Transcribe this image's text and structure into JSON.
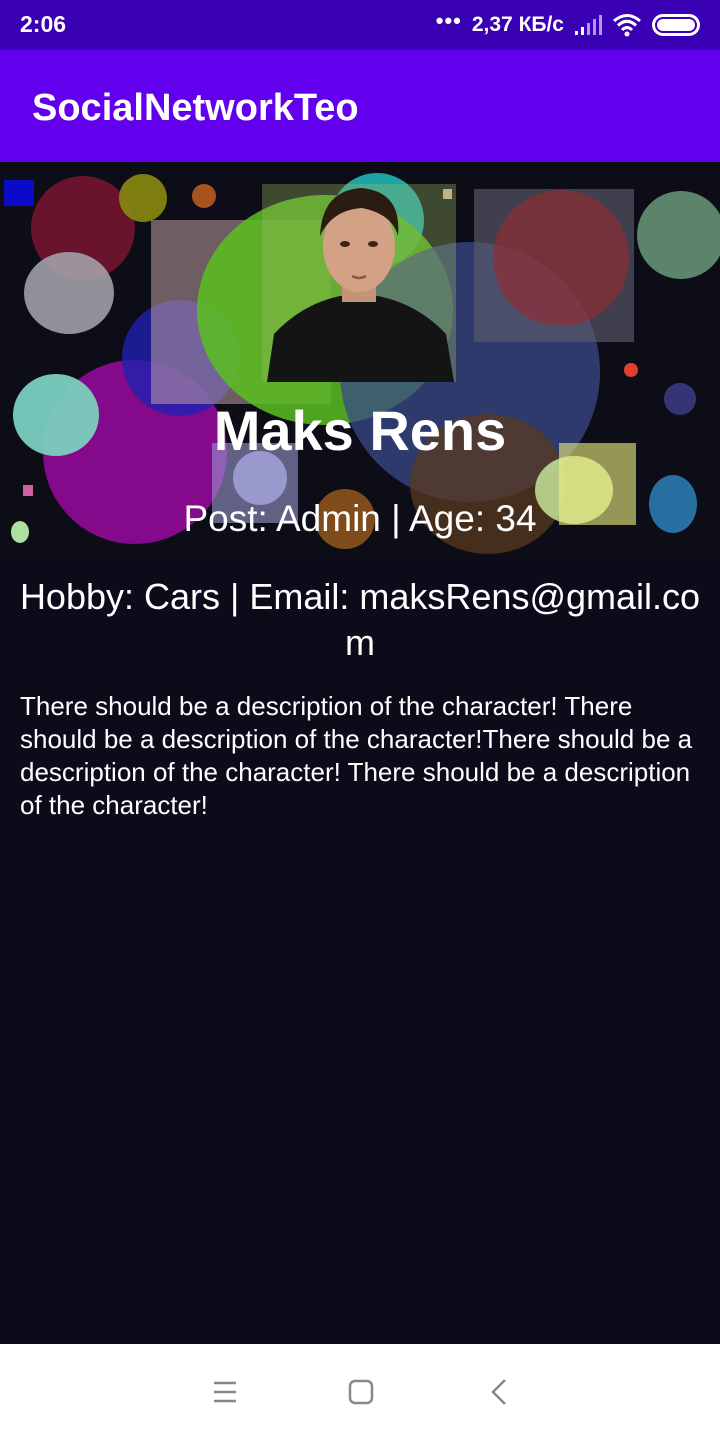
{
  "status_bar": {
    "time": "2:06",
    "dots": "•••",
    "network_speed": "2,37 КБ/с",
    "icons": [
      "signal-icon",
      "wifi-icon",
      "battery-icon"
    ]
  },
  "app_bar": {
    "title": "SocialNetworkTeo",
    "color": "#6200ee"
  },
  "profile": {
    "avatar_icon": "user-photo",
    "name": "Maks Rens",
    "post_line": "Post: Admin | Age: 34",
    "hobby_line": "Hobby: Cars | Email: maksRens@gmail.com",
    "description": "There should be a description of the character! There should be a description of the character!There should be a description of the character! There should be a description of the character!"
  },
  "nav_bar": {
    "buttons": [
      "menu-icon",
      "home-icon",
      "back-icon"
    ]
  },
  "colors": {
    "status_bar": "#3a00b3",
    "app_bar": "#6200ee",
    "background": "#0b0b1a",
    "text": "#ffffff"
  }
}
